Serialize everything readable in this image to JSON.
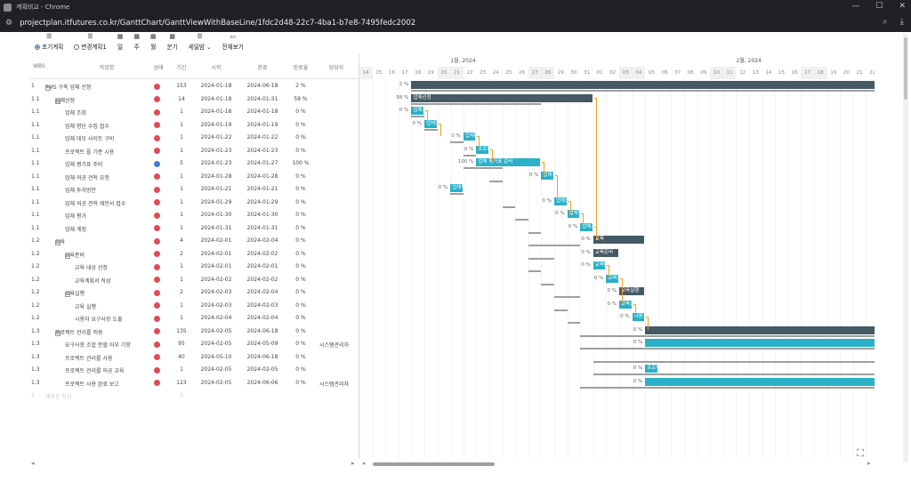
{
  "window": {
    "title": "계획비교 - Chrome",
    "minimize": "—",
    "maximize": "☐",
    "close": "✕"
  },
  "address": {
    "url": "projectplan.itfutures.co.kr/GanttChart/GanttViewWithBaseLine/1fdc2d48-22c7-4ba1-b7e8-7495fedc2002"
  },
  "toolbar": {
    "initial_plan": "초기계획",
    "changed_plan": "변경계획1",
    "day": "일",
    "week": "주",
    "month": "월",
    "quarter": "분기",
    "detail": "세밀밤",
    "show_all": "전체보기"
  },
  "grid": {
    "headers": [
      "WBS",
      "작업명",
      "상태",
      "기간",
      "시작",
      "완료",
      "완료율",
      "담당자"
    ],
    "rows": [
      {
        "wbs": "1",
        "name": "PMS 구축 업체 선정",
        "level": 0,
        "expand": true,
        "status": "red",
        "dur": "153",
        "start": "2024-01-18",
        "end": "2024-06-18",
        "pct": "2 %",
        "owner": ""
      },
      {
        "wbs": "1.1",
        "name": "업체선정",
        "level": 1,
        "expand": true,
        "status": "red",
        "dur": "14",
        "start": "2024-01-18",
        "end": "2024-01-31",
        "pct": "58 %",
        "owner": ""
      },
      {
        "wbs": "1.1",
        "name": "업체 조회",
        "level": 2,
        "expand": false,
        "status": "red",
        "dur": "1",
        "start": "2024-01-18",
        "end": "2024-01-18",
        "pct": "0 %",
        "owner": ""
      },
      {
        "wbs": "1.1",
        "name": "업체 명단 수집 접수",
        "level": 2,
        "expand": false,
        "status": "red",
        "dur": "1",
        "start": "2024-01-19",
        "end": "2024-01-19",
        "pct": "0 %",
        "owner": ""
      },
      {
        "wbs": "1.1",
        "name": "업체 데모 사이트 구비",
        "level": 2,
        "expand": false,
        "status": "red",
        "dur": "1",
        "start": "2024-01-22",
        "end": "2024-01-22",
        "pct": "0 %",
        "owner": ""
      },
      {
        "wbs": "1.1",
        "name": "프로젝트 플 기준 시용",
        "level": 2,
        "expand": false,
        "status": "red",
        "dur": "1",
        "start": "2024-01-23",
        "end": "2024-01-23",
        "pct": "0 %",
        "owner": ""
      },
      {
        "wbs": "1.1",
        "name": "업체 평가표 주비",
        "level": 2,
        "expand": false,
        "status": "blue",
        "dur": "5",
        "start": "2024-01-23",
        "end": "2024-01-27",
        "pct": "100 %",
        "owner": ""
      },
      {
        "wbs": "1.1",
        "name": "업체 의공 견적 요청",
        "level": 2,
        "expand": false,
        "status": "red",
        "dur": "1",
        "start": "2024-01-28",
        "end": "2024-01-28",
        "pct": "0 %",
        "owner": ""
      },
      {
        "wbs": "1.1",
        "name": "업체 투자방안",
        "level": 2,
        "expand": false,
        "status": "red",
        "dur": "1",
        "start": "2024-01-21",
        "end": "2024-01-21",
        "pct": "0 %",
        "owner": ""
      },
      {
        "wbs": "1.1",
        "name": "업체 의공 견적 제안서 접수",
        "level": 2,
        "expand": false,
        "status": "red",
        "dur": "1",
        "start": "2024-01-29",
        "end": "2024-01-29",
        "pct": "0 %",
        "owner": ""
      },
      {
        "wbs": "1.1",
        "name": "업체 평가",
        "level": 2,
        "expand": false,
        "status": "red",
        "dur": "1",
        "start": "2024-01-30",
        "end": "2024-01-30",
        "pct": "0 %",
        "owner": ""
      },
      {
        "wbs": "1.1",
        "name": "업체 계정",
        "level": 2,
        "expand": false,
        "status": "red",
        "dur": "1",
        "start": "2024-01-31",
        "end": "2024-01-31",
        "pct": "0 %",
        "owner": ""
      },
      {
        "wbs": "1.2",
        "name": "교육",
        "level": 1,
        "expand": true,
        "status": "red",
        "dur": "4",
        "start": "2024-02-01",
        "end": "2024-02-04",
        "pct": "0 %",
        "owner": ""
      },
      {
        "wbs": "1.2",
        "name": "교육준비",
        "level": 2,
        "expand": true,
        "status": "red",
        "dur": "2",
        "start": "2024-02-01",
        "end": "2024-02-02",
        "pct": "0 %",
        "owner": ""
      },
      {
        "wbs": "1.2",
        "name": "교육 대상 선정",
        "level": 3,
        "expand": false,
        "status": "red",
        "dur": "1",
        "start": "2024-02-01",
        "end": "2024-02-01",
        "pct": "0 %",
        "owner": ""
      },
      {
        "wbs": "1.2",
        "name": "교육계획서 작성",
        "level": 3,
        "expand": false,
        "status": "red",
        "dur": "1",
        "start": "2024-02-02",
        "end": "2024-02-02",
        "pct": "0 %",
        "owner": ""
      },
      {
        "wbs": "1.2",
        "name": "교육실행",
        "level": 2,
        "expand": true,
        "status": "red",
        "dur": "2",
        "start": "2024-02-03",
        "end": "2024-02-04",
        "pct": "0 %",
        "owner": ""
      },
      {
        "wbs": "1.2",
        "name": "교육 실행",
        "level": 3,
        "expand": false,
        "status": "red",
        "dur": "1",
        "start": "2024-02-03",
        "end": "2024-02-03",
        "pct": "0 %",
        "owner": ""
      },
      {
        "wbs": "1.2",
        "name": "시용자 요구사항 도출",
        "level": 3,
        "expand": false,
        "status": "red",
        "dur": "1",
        "start": "2024-02-04",
        "end": "2024-02-04",
        "pct": "0 %",
        "owner": ""
      },
      {
        "wbs": "1.3",
        "name": "프로젝트 관리를 적용",
        "level": 1,
        "expand": true,
        "status": "red",
        "dur": "135",
        "start": "2024-02-05",
        "end": "2024-06-18",
        "pct": "0 %",
        "owner": ""
      },
      {
        "wbs": "1.3",
        "name": "요구사항 조합 분할 어부 기항",
        "level": 2,
        "expand": false,
        "status": "red",
        "dur": "95",
        "start": "2024-02-05",
        "end": "2024-05-09",
        "pct": "0 %",
        "owner": "시스템관리자"
      },
      {
        "wbs": "1.3",
        "name": "프로젝트 관리를 사용",
        "level": 2,
        "expand": false,
        "status": "red",
        "dur": "40",
        "start": "2024-05-10",
        "end": "2024-06-18",
        "pct": "0 %",
        "owner": ""
      },
      {
        "wbs": "1.3",
        "name": "프로젝트 관리를 의공 교육",
        "level": 2,
        "expand": false,
        "status": "red",
        "dur": "1",
        "start": "2024-02-05",
        "end": "2024-02-05",
        "pct": "0 %",
        "owner": ""
      },
      {
        "wbs": "1.3",
        "name": "프로젝트 사용 완료 보고",
        "level": 2,
        "expand": false,
        "status": "red",
        "dur": "123",
        "start": "2024-02-05",
        "end": "2024-06-06",
        "pct": "0 %",
        "owner": "시스템관리자"
      },
      {
        "wbs": "2",
        "name": "새로운 작업",
        "level": 0,
        "expand": false,
        "status": "",
        "dur": "1",
        "start": "",
        "end": "",
        "pct": "",
        "owner": "",
        "ghost": true
      }
    ]
  },
  "gantt": {
    "months": [
      {
        "label": "1월, 2024",
        "at": 7
      },
      {
        "label": "2월, 2024",
        "at": 29
      }
    ],
    "days": [
      "14",
      "15",
      "16",
      "17",
      "18",
      "19",
      "20",
      "21",
      "22",
      "23",
      "24",
      "25",
      "26",
      "27",
      "28",
      "29",
      "30",
      "31",
      "01",
      "02",
      "03",
      "04",
      "05",
      "06",
      "07",
      "08",
      "09",
      "10",
      "11",
      "12",
      "13",
      "14",
      "15",
      "16",
      "17",
      "18",
      "19",
      "20",
      "21",
      "22"
    ],
    "weekends": [
      0,
      6,
      7,
      13,
      14,
      20,
      21,
      27,
      28,
      34,
      35
    ],
    "bars": [
      {
        "row": 0,
        "kind": "summary",
        "start": 4,
        "len": 40,
        "label": "",
        "pct": "2 %",
        "base": [
          4,
          40
        ]
      },
      {
        "row": 1,
        "kind": "summary",
        "start": 4,
        "len": 14,
        "label": "업체선정",
        "pct": "58 %",
        "base": [
          4,
          10
        ]
      },
      {
        "row": 2,
        "kind": "task",
        "start": 4,
        "len": 1,
        "label": "업체조",
        "pct": "0 %",
        "base": [
          4,
          1
        ]
      },
      {
        "row": 3,
        "kind": "task",
        "start": 5,
        "len": 1,
        "label": "업체명",
        "pct": "0 %",
        "base": [
          5,
          1
        ]
      },
      {
        "row": 4,
        "kind": "task",
        "start": 8,
        "len": 1,
        "label": "업체데",
        "pct": "0 %",
        "base": [
          7,
          1
        ]
      },
      {
        "row": 5,
        "kind": "task",
        "start": 9,
        "len": 1,
        "label": "프로젝",
        "pct": "0 %",
        "base": [
          8,
          1
        ]
      },
      {
        "row": 6,
        "kind": "task",
        "start": 9,
        "len": 5,
        "label": "업체 평가표 준비",
        "pct": "100 %",
        "base": [
          8,
          3
        ]
      },
      {
        "row": 7,
        "kind": "task",
        "start": 14,
        "len": 1,
        "label": "업체의",
        "pct": "0 %",
        "base": [
          10,
          1
        ]
      },
      {
        "row": 8,
        "kind": "task",
        "start": 7,
        "len": 1,
        "label": "업체투",
        "pct": "0 %",
        "base": [
          7,
          1
        ]
      },
      {
        "row": 9,
        "kind": "task",
        "start": 15,
        "len": 1,
        "label": "업체의",
        "pct": "0 %",
        "base": [
          11,
          1
        ]
      },
      {
        "row": 10,
        "kind": "task",
        "start": 16,
        "len": 1,
        "label": "업체평",
        "pct": "0 %",
        "base": [
          12,
          1
        ]
      },
      {
        "row": 11,
        "kind": "task",
        "start": 17,
        "len": 1,
        "label": "업체계",
        "pct": "0 %",
        "base": [
          13,
          1
        ]
      },
      {
        "row": 12,
        "kind": "summary",
        "start": 18,
        "len": 4,
        "label": "교육",
        "pct": "0 %",
        "base": [
          13,
          4
        ]
      },
      {
        "row": 13,
        "kind": "summary",
        "start": 18,
        "len": 2,
        "label": "교육준비",
        "pct": "0 %",
        "base": [
          13,
          2
        ]
      },
      {
        "row": 14,
        "kind": "task",
        "start": 18,
        "len": 1,
        "label": "교육대",
        "pct": "0 %",
        "base": [
          13,
          1
        ]
      },
      {
        "row": 15,
        "kind": "task",
        "start": 19,
        "len": 1,
        "label": "교육계",
        "pct": "0 %",
        "base": [
          14,
          1
        ]
      },
      {
        "row": 16,
        "kind": "summary",
        "start": 20,
        "len": 2,
        "label": "교육실행",
        "pct": "0 %",
        "base": [
          15,
          2
        ]
      },
      {
        "row": 17,
        "kind": "task",
        "start": 20,
        "len": 1,
        "label": "교육실",
        "pct": "0 %",
        "base": [
          15,
          1
        ]
      },
      {
        "row": 18,
        "kind": "task",
        "start": 21,
        "len": 1,
        "label": "사용자",
        "pct": "0 %",
        "base": [
          16,
          1
        ]
      },
      {
        "row": 19,
        "kind": "summary",
        "start": 22,
        "len": 18,
        "label": "",
        "pct": "0 %",
        "base": [
          17,
          23
        ]
      },
      {
        "row": 20,
        "kind": "task",
        "start": 22,
        "len": 18,
        "label": "",
        "pct": "0 %",
        "base": [
          17,
          23
        ]
      },
      {
        "row": 21,
        "kind": "task",
        "start": 0,
        "len": 0,
        "label": "",
        "pct": "",
        "base": [
          18,
          22
        ]
      },
      {
        "row": 22,
        "kind": "task",
        "start": 22,
        "len": 1,
        "label": "프로젝",
        "pct": "0 %",
        "base": [
          18,
          22
        ]
      },
      {
        "row": 23,
        "kind": "task",
        "start": 22,
        "len": 18,
        "label": "",
        "pct": "0 %",
        "base": [
          17,
          23
        ]
      }
    ]
  },
  "icons": {
    "fullscreen": "⛶"
  }
}
